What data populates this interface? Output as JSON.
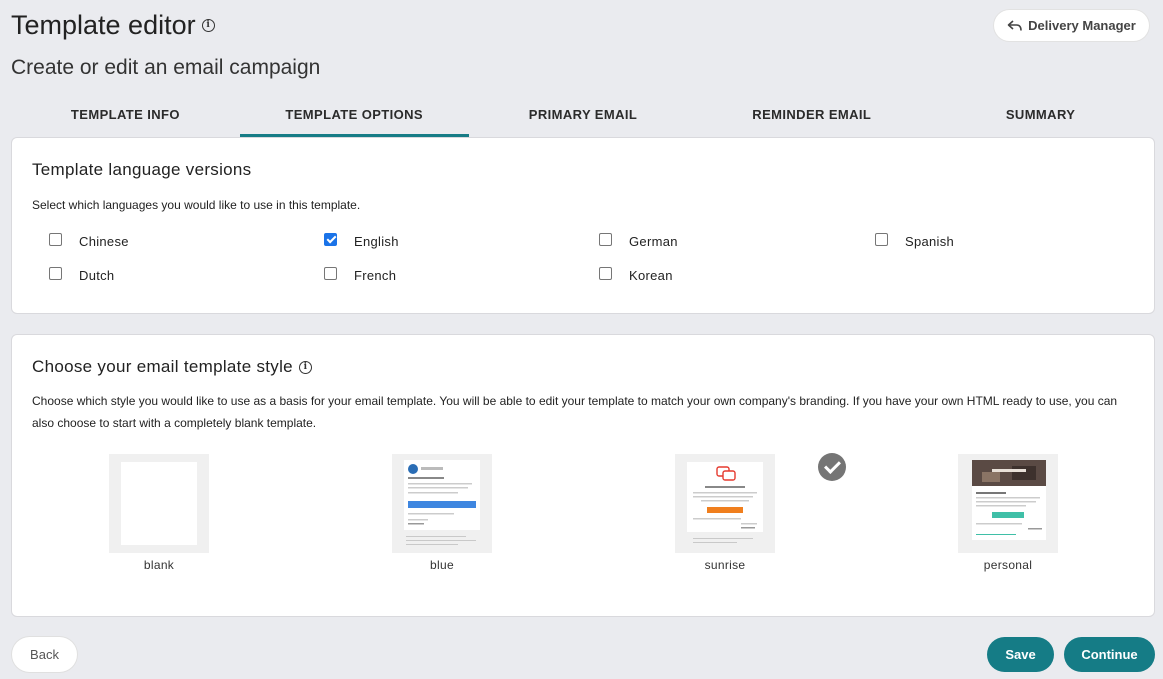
{
  "header": {
    "title": "Template editor",
    "subtitle": "Create or edit an email campaign",
    "info_icon": "i",
    "delivery_manager_label": "Delivery Manager"
  },
  "tabs": [
    {
      "label": "TEMPLATE INFO",
      "active": false
    },
    {
      "label": "TEMPLATE OPTIONS",
      "active": true
    },
    {
      "label": "PRIMARY EMAIL",
      "active": false
    },
    {
      "label": "REMINDER EMAIL",
      "active": false
    },
    {
      "label": "SUMMARY",
      "active": false
    }
  ],
  "languages": {
    "title": "Template language versions",
    "description": "Select which languages you would like to use in this template.",
    "items": [
      {
        "label": "Chinese",
        "checked": false
      },
      {
        "label": "English",
        "checked": true
      },
      {
        "label": "German",
        "checked": false
      },
      {
        "label": "Spanish",
        "checked": false
      },
      {
        "label": "Dutch",
        "checked": false
      },
      {
        "label": "French",
        "checked": false
      },
      {
        "label": "Korean",
        "checked": false
      }
    ]
  },
  "styles": {
    "title": "Choose your email template style",
    "info_icon": "i",
    "description": "Choose which style you would like to use as a basis for your email template. You will be able to edit your template to match your own company's branding. If you have your own HTML ready to use, you can also choose to start with a completely blank template.",
    "templates": [
      {
        "name": "blank",
        "selected": false
      },
      {
        "name": "blue",
        "selected": false
      },
      {
        "name": "sunrise",
        "selected": true
      },
      {
        "name": "personal",
        "selected": false
      }
    ]
  },
  "footer": {
    "back_label": "Back",
    "save_label": "Save",
    "continue_label": "Continue"
  },
  "colors": {
    "accent": "#157c86",
    "checkbox": "#1a73e8",
    "background": "#eaebef"
  }
}
